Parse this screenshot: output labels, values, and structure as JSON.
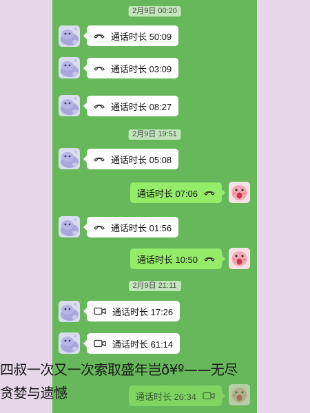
{
  "timestamps": [
    "2月9日 00:20",
    "2月9日 19:51",
    "2月9日 21:11"
  ],
  "messages": [
    {
      "text": "通话时长 50:09",
      "icon": "phone-icon"
    },
    {
      "text": "通话时长 03:09",
      "icon": "phone-icon"
    },
    {
      "text": "通话时长 08:27",
      "icon": "phone-icon"
    },
    {
      "text": "通话时长 05:08",
      "icon": "phone-icon"
    },
    {
      "text": "通话时长 07:06",
      "icon": "phone-icon"
    },
    {
      "text": "通话时长 01:56",
      "icon": "phone-icon"
    },
    {
      "text": "通话时长 10:50",
      "icon": "phone-icon"
    },
    {
      "text": "通话时长 17:26",
      "icon": "video-icon"
    },
    {
      "text": "通话时长 61:14",
      "icon": "video-icon"
    },
    {
      "text": "通话时长 26:34",
      "icon": "video-icon"
    }
  ],
  "caption": {
    "line1": "四叔一次又一次索取盛年岂ð¥º——无尽",
    "line2": "贪婪与遗憾"
  },
  "colors": {
    "chat_background": "#66b85a",
    "page_background": "#e7d6ea",
    "incoming_bubble": "#ffffff",
    "outgoing_bubble": "#95ec69"
  }
}
